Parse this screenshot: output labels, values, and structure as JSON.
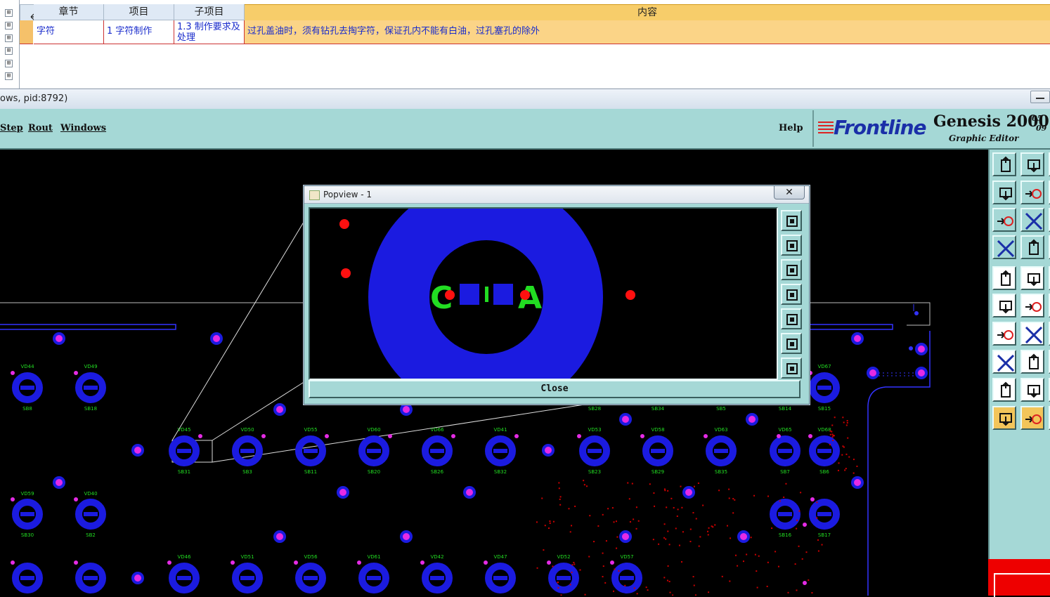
{
  "grid": {
    "headers": {
      "chapter": "章节",
      "item": "项目",
      "subitem": "子项目",
      "content": "内容"
    },
    "row": {
      "chapter": "字符",
      "item": "1 字符制作",
      "subitem": "1.3 制作要求及处理",
      "content": "过孔盖油时，须有钻孔去掏字符，保证孔内不能有白油，过孔塞孔的除外"
    },
    "expander_glyph": "⊞"
  },
  "window": {
    "title": "ows, pid:8792)"
  },
  "menu": {
    "step": "Step",
    "rout": "Rout",
    "windows": "Windows",
    "help": "Help"
  },
  "logo": {
    "brand": "Frontline",
    "product": "Genesis 2000",
    "version_top": "05",
    "version_bottom": "09",
    "subtitle": "Graphic Editor"
  },
  "popview": {
    "title": "Popview - 1",
    "close_x": "✕",
    "close_label": "Close",
    "letter_left": "C",
    "letter_right": "A"
  },
  "pcb": {
    "labels_row1": [
      "VD44",
      "VD49",
      "VD67"
    ],
    "labels_row1_bottom": [
      "SB8",
      "SB18",
      "SB28",
      "SB34",
      "SB5",
      "SB14",
      "SB15"
    ],
    "labels_row2": [
      "VD45",
      "VD50",
      "VD55",
      "VD60",
      "VD66",
      "VD41",
      "VD53",
      "VD58",
      "VD63",
      "VD65",
      "VD68"
    ],
    "labels_row2_bottom": [
      "SB31",
      "SB3",
      "SB11",
      "SB20",
      "SB26",
      "SB32",
      "SB23",
      "SB29",
      "SB35",
      "SB7",
      "SB6"
    ],
    "labels_row3": [
      "VD59",
      "VD40"
    ],
    "labels_row3_bottom": [
      "SB30",
      "SB2",
      "SB16",
      "SB17"
    ],
    "labels_row4": [
      "VD46",
      "VD51",
      "VD56",
      "VD61",
      "VD42",
      "VD47",
      "VD52",
      "VD57"
    ],
    "colors": {
      "pad": "#1b1be0",
      "via": "#e52be5",
      "label": "#22dd22",
      "drill": "#ff1010"
    }
  }
}
